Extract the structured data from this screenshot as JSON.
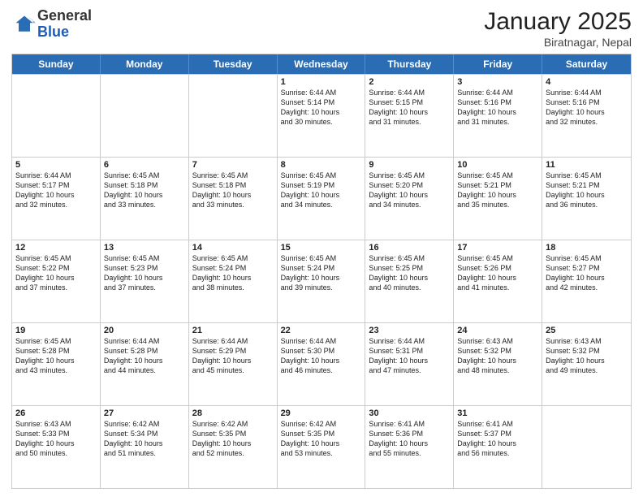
{
  "header": {
    "logo_general": "General",
    "logo_blue": "Blue",
    "month_year": "January 2025",
    "location": "Biratnagar, Nepal"
  },
  "days_of_week": [
    "Sunday",
    "Monday",
    "Tuesday",
    "Wednesday",
    "Thursday",
    "Friday",
    "Saturday"
  ],
  "weeks": [
    [
      {
        "day": "",
        "info": ""
      },
      {
        "day": "",
        "info": ""
      },
      {
        "day": "",
        "info": ""
      },
      {
        "day": "1",
        "info": "Sunrise: 6:44 AM\nSunset: 5:14 PM\nDaylight: 10 hours\nand 30 minutes."
      },
      {
        "day": "2",
        "info": "Sunrise: 6:44 AM\nSunset: 5:15 PM\nDaylight: 10 hours\nand 31 minutes."
      },
      {
        "day": "3",
        "info": "Sunrise: 6:44 AM\nSunset: 5:16 PM\nDaylight: 10 hours\nand 31 minutes."
      },
      {
        "day": "4",
        "info": "Sunrise: 6:44 AM\nSunset: 5:16 PM\nDaylight: 10 hours\nand 32 minutes."
      }
    ],
    [
      {
        "day": "5",
        "info": "Sunrise: 6:44 AM\nSunset: 5:17 PM\nDaylight: 10 hours\nand 32 minutes."
      },
      {
        "day": "6",
        "info": "Sunrise: 6:45 AM\nSunset: 5:18 PM\nDaylight: 10 hours\nand 33 minutes."
      },
      {
        "day": "7",
        "info": "Sunrise: 6:45 AM\nSunset: 5:18 PM\nDaylight: 10 hours\nand 33 minutes."
      },
      {
        "day": "8",
        "info": "Sunrise: 6:45 AM\nSunset: 5:19 PM\nDaylight: 10 hours\nand 34 minutes."
      },
      {
        "day": "9",
        "info": "Sunrise: 6:45 AM\nSunset: 5:20 PM\nDaylight: 10 hours\nand 34 minutes."
      },
      {
        "day": "10",
        "info": "Sunrise: 6:45 AM\nSunset: 5:21 PM\nDaylight: 10 hours\nand 35 minutes."
      },
      {
        "day": "11",
        "info": "Sunrise: 6:45 AM\nSunset: 5:21 PM\nDaylight: 10 hours\nand 36 minutes."
      }
    ],
    [
      {
        "day": "12",
        "info": "Sunrise: 6:45 AM\nSunset: 5:22 PM\nDaylight: 10 hours\nand 37 minutes."
      },
      {
        "day": "13",
        "info": "Sunrise: 6:45 AM\nSunset: 5:23 PM\nDaylight: 10 hours\nand 37 minutes."
      },
      {
        "day": "14",
        "info": "Sunrise: 6:45 AM\nSunset: 5:24 PM\nDaylight: 10 hours\nand 38 minutes."
      },
      {
        "day": "15",
        "info": "Sunrise: 6:45 AM\nSunset: 5:24 PM\nDaylight: 10 hours\nand 39 minutes."
      },
      {
        "day": "16",
        "info": "Sunrise: 6:45 AM\nSunset: 5:25 PM\nDaylight: 10 hours\nand 40 minutes."
      },
      {
        "day": "17",
        "info": "Sunrise: 6:45 AM\nSunset: 5:26 PM\nDaylight: 10 hours\nand 41 minutes."
      },
      {
        "day": "18",
        "info": "Sunrise: 6:45 AM\nSunset: 5:27 PM\nDaylight: 10 hours\nand 42 minutes."
      }
    ],
    [
      {
        "day": "19",
        "info": "Sunrise: 6:45 AM\nSunset: 5:28 PM\nDaylight: 10 hours\nand 43 minutes."
      },
      {
        "day": "20",
        "info": "Sunrise: 6:44 AM\nSunset: 5:28 PM\nDaylight: 10 hours\nand 44 minutes."
      },
      {
        "day": "21",
        "info": "Sunrise: 6:44 AM\nSunset: 5:29 PM\nDaylight: 10 hours\nand 45 minutes."
      },
      {
        "day": "22",
        "info": "Sunrise: 6:44 AM\nSunset: 5:30 PM\nDaylight: 10 hours\nand 46 minutes."
      },
      {
        "day": "23",
        "info": "Sunrise: 6:44 AM\nSunset: 5:31 PM\nDaylight: 10 hours\nand 47 minutes."
      },
      {
        "day": "24",
        "info": "Sunrise: 6:43 AM\nSunset: 5:32 PM\nDaylight: 10 hours\nand 48 minutes."
      },
      {
        "day": "25",
        "info": "Sunrise: 6:43 AM\nSunset: 5:32 PM\nDaylight: 10 hours\nand 49 minutes."
      }
    ],
    [
      {
        "day": "26",
        "info": "Sunrise: 6:43 AM\nSunset: 5:33 PM\nDaylight: 10 hours\nand 50 minutes."
      },
      {
        "day": "27",
        "info": "Sunrise: 6:42 AM\nSunset: 5:34 PM\nDaylight: 10 hours\nand 51 minutes."
      },
      {
        "day": "28",
        "info": "Sunrise: 6:42 AM\nSunset: 5:35 PM\nDaylight: 10 hours\nand 52 minutes."
      },
      {
        "day": "29",
        "info": "Sunrise: 6:42 AM\nSunset: 5:35 PM\nDaylight: 10 hours\nand 53 minutes."
      },
      {
        "day": "30",
        "info": "Sunrise: 6:41 AM\nSunset: 5:36 PM\nDaylight: 10 hours\nand 55 minutes."
      },
      {
        "day": "31",
        "info": "Sunrise: 6:41 AM\nSunset: 5:37 PM\nDaylight: 10 hours\nand 56 minutes."
      },
      {
        "day": "",
        "info": ""
      }
    ]
  ]
}
